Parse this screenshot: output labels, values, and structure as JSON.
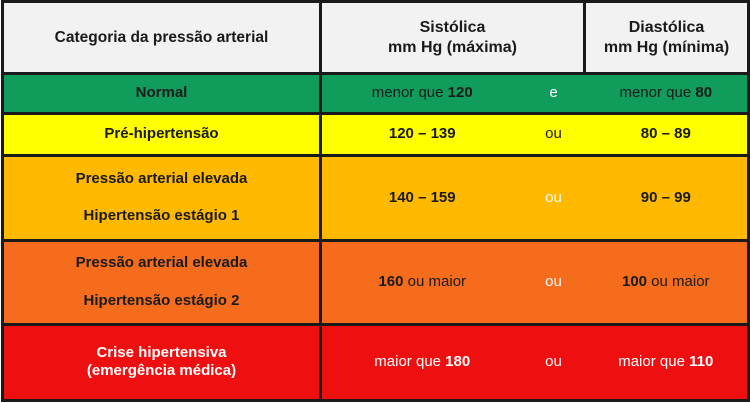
{
  "header": {
    "category": "Categoria da pressão arterial",
    "systolic_line1": "Sistólica",
    "systolic_line2": "mm Hg (máxima)",
    "diastolic_line1": "Diastólica",
    "diastolic_line2": "mm Hg (mínima)"
  },
  "rows": [
    {
      "category_lines": [
        "Normal"
      ],
      "systolic": {
        "pre": "menor que ",
        "bold": "120",
        "post": ""
      },
      "conjunction": "e",
      "diastolic": {
        "pre": "menor que ",
        "bold": "80",
        "post": ""
      },
      "color": "#109c5a"
    },
    {
      "category_lines": [
        "Pré-hipertensão"
      ],
      "systolic": {
        "pre": "",
        "bold": "120 – 139",
        "post": ""
      },
      "conjunction": "ou",
      "diastolic": {
        "pre": "",
        "bold": "80 – 89",
        "post": ""
      },
      "color": "#ffff00"
    },
    {
      "category_lines": [
        "Pressão arterial elevada",
        "Hipertensão estágio 1"
      ],
      "systolic": {
        "pre": "",
        "bold": "140 – 159",
        "post": ""
      },
      "conjunction": "ou",
      "diastolic": {
        "pre": "",
        "bold": "90 – 99",
        "post": ""
      },
      "color": "#ffb900"
    },
    {
      "category_lines": [
        "Pressão arterial elevada",
        "Hipertensão estágio 2"
      ],
      "systolic": {
        "pre": "",
        "bold": "160",
        "post": " ou maior"
      },
      "conjunction": "ou",
      "diastolic": {
        "pre": "",
        "bold": "100",
        "post": " ou maior"
      },
      "color": "#f46c1c"
    },
    {
      "category_lines": [
        "Crise hipertensiva",
        "(emergência médica)"
      ],
      "systolic": {
        "pre": "maior que ",
        "bold": "180",
        "post": ""
      },
      "conjunction": "ou",
      "diastolic": {
        "pre": "maior que ",
        "bold": "110",
        "post": ""
      },
      "color": "#ee1010"
    }
  ]
}
